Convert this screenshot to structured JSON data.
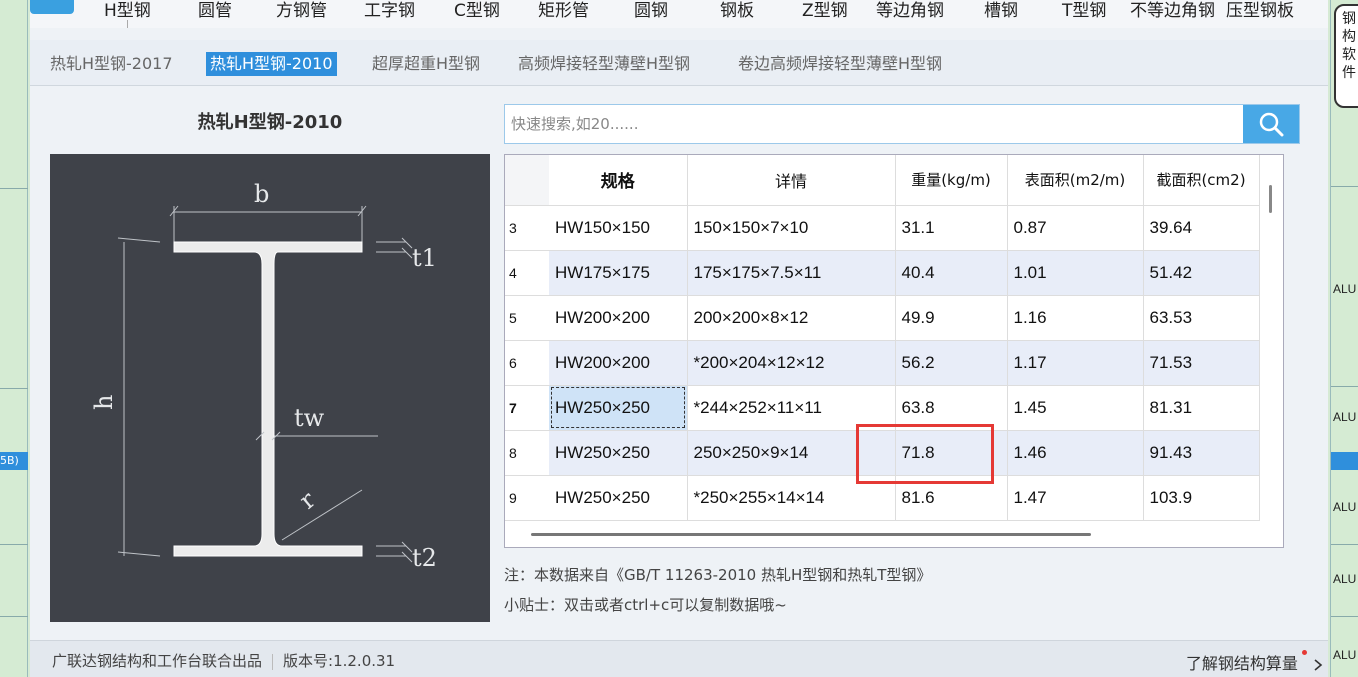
{
  "top_nav": [
    "H型钢",
    "圆管",
    "方钢管",
    "工字钢",
    "C型钢",
    "矩形管",
    "圆钢",
    "钢板",
    "Z型钢",
    "等边角钢",
    "槽钢",
    "T型钢",
    "不等边角钢",
    "压型钢板"
  ],
  "sub_nav": [
    {
      "label": "热轧H型钢-2017",
      "active": false
    },
    {
      "label": "热轧H型钢-2010",
      "active": true
    },
    {
      "label": "超厚超重H型钢",
      "active": false
    },
    {
      "label": "高频焊接轻型薄壁H型钢",
      "active": false
    },
    {
      "label": "卷边高频焊接轻型薄壁H型钢",
      "active": false
    }
  ],
  "figure": {
    "title": "热轧H型钢-2010",
    "labels": {
      "b": "b",
      "h": "h",
      "t1": "t1",
      "t2": "t2",
      "tw": "tw",
      "r": "r"
    }
  },
  "search": {
    "placeholder": "快速搜索,如20......"
  },
  "table": {
    "columns": [
      "规格",
      "详情",
      "重量(kg/m)",
      "表面积(m2/m)",
      "截面积(cm2)"
    ],
    "rows": [
      {
        "idx": "3",
        "spec": "HW150×150",
        "detail": "150×150×7×10",
        "weight": "31.1",
        "area_surface": "0.87",
        "area_section": "39.64"
      },
      {
        "idx": "4",
        "spec": "HW175×175",
        "detail": "175×175×7.5×11",
        "weight": "40.4",
        "area_surface": "1.01",
        "area_section": "51.42"
      },
      {
        "idx": "5",
        "spec": "HW200×200",
        "detail": "200×200×8×12",
        "weight": "49.9",
        "area_surface": "1.16",
        "area_section": "63.53"
      },
      {
        "idx": "6",
        "spec": "HW200×200",
        "detail": "*200×204×12×12",
        "weight": "56.2",
        "area_surface": "1.17",
        "area_section": "71.53"
      },
      {
        "idx": "7",
        "spec": "HW250×250",
        "detail": "*244×252×11×11",
        "weight": "63.8",
        "area_surface": "1.45",
        "area_section": "81.31"
      },
      {
        "idx": "8",
        "spec": "HW250×250",
        "detail": "250×250×9×14",
        "weight": "71.8",
        "area_surface": "1.46",
        "area_section": "91.43"
      },
      {
        "idx": "9",
        "spec": "HW250×250",
        "detail": "*250×255×14×14",
        "weight": "81.6",
        "area_surface": "1.47",
        "area_section": "103.9"
      }
    ]
  },
  "note": "注：本数据来自《GB/T 11263-2010 热轧H型钢和热轧T型钢》",
  "tip": "小贴士：双击或者ctrl+c可以复制数据哦~",
  "footer": {
    "publisher": "广联达钢结构和工作台联合出品",
    "version": "版本号:1.2.0.31",
    "learn_more": "了解钢结构算量"
  },
  "background": {
    "left_cell": "5B)",
    "right_cells": [
      "ALU",
      "ALU",
      "ALU",
      "ALU",
      "ALU"
    ],
    "bubble_text": "钢构软件"
  },
  "colors": {
    "accent": "#2f8fdc",
    "highlight": "#e53935",
    "figure_bg": "#3f4249"
  }
}
